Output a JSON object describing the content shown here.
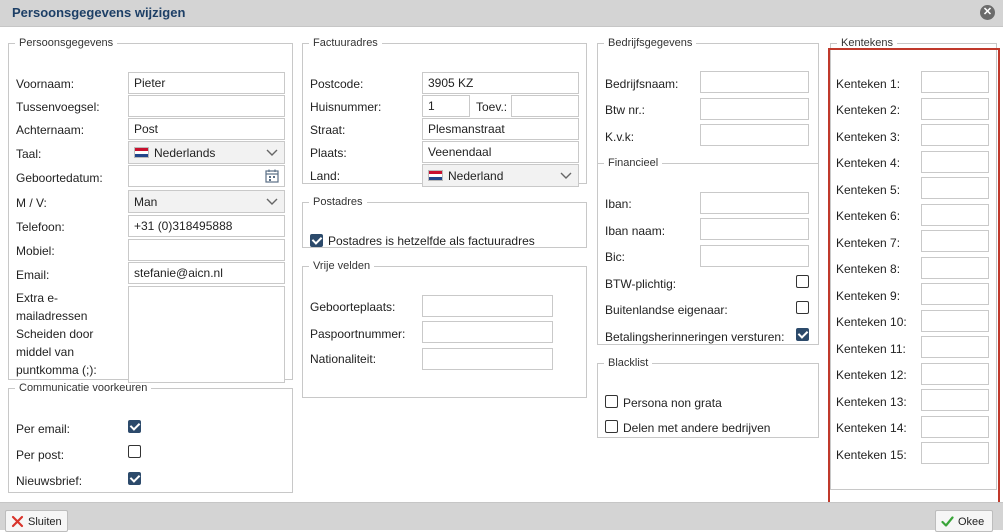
{
  "dialog": {
    "title": "Persoonsgegevens wijzigen",
    "close_icon": "close-icon"
  },
  "persoonsgegevens": {
    "legend": "Persoonsgegevens",
    "voornaam": {
      "label": "Voornaam:",
      "value": "Pieter"
    },
    "tussenvoegsel": {
      "label": "Tussenvoegsel:",
      "value": ""
    },
    "achternaam": {
      "label": "Achternaam:",
      "value": "Post"
    },
    "taal": {
      "label": "Taal:",
      "value": "Nederlands"
    },
    "geboortedatum": {
      "label": "Geboortedatum:",
      "value": ""
    },
    "mv": {
      "label": "M / V:",
      "value": "Man"
    },
    "telefoon": {
      "label": "Telefoon:",
      "value": "+31 (0)318495888"
    },
    "mobiel": {
      "label": "Mobiel:",
      "value": ""
    },
    "email": {
      "label": "Email:",
      "value": "stefanie@aicn.nl"
    },
    "extra": {
      "label_lines": [
        "Extra e-",
        "mailadressen",
        "Scheiden door",
        "middel van",
        "puntkomma (;):"
      ],
      "value": ""
    }
  },
  "communicatie": {
    "legend": "Communicatie voorkeuren",
    "items": [
      {
        "label": "Per email:",
        "checked": true
      },
      {
        "label": "Per post:",
        "checked": false
      },
      {
        "label": "Nieuwsbrief:",
        "checked": true
      }
    ]
  },
  "factuuradres": {
    "legend": "Factuuradres",
    "postcode": {
      "label": "Postcode:",
      "value": "3905 KZ"
    },
    "huisnummer": {
      "label": "Huisnummer:",
      "value": "1"
    },
    "toev": {
      "label": "Toev.:",
      "value": ""
    },
    "straat": {
      "label": "Straat:",
      "value": "Plesmanstraat"
    },
    "plaats": {
      "label": "Plaats:",
      "value": "Veenendaal"
    },
    "land": {
      "label": "Land:",
      "value": "Nederland"
    }
  },
  "postadres": {
    "legend": "Postadres",
    "checkbox_label": "Postadres is hetzelfde als factuuradres",
    "checked": true
  },
  "vrije_velden": {
    "legend": "Vrije velden",
    "fields": [
      {
        "label": "Geboorteplaats:",
        "value": ""
      },
      {
        "label": "Paspoortnummer:",
        "value": ""
      },
      {
        "label": "Nationaliteit:",
        "value": ""
      }
    ]
  },
  "bedrijfsgegevens": {
    "legend": "Bedrijfsgegevens",
    "fields": [
      {
        "label": "Bedrijfsnaam:",
        "value": ""
      },
      {
        "label": "Btw nr.:",
        "value": ""
      },
      {
        "label": "K.v.k:",
        "value": ""
      }
    ]
  },
  "financieel": {
    "legend": "Financieel",
    "fields": [
      {
        "label": "Iban:",
        "value": ""
      },
      {
        "label": "Iban naam:",
        "value": ""
      },
      {
        "label": "Bic:",
        "value": ""
      }
    ],
    "checkboxes": [
      {
        "label": "BTW-plichtig:",
        "checked": false
      },
      {
        "label": "Buitenlandse eigenaar:",
        "checked": false
      },
      {
        "label": "Betalingsherinneringen versturen:",
        "checked": true
      }
    ]
  },
  "blacklist": {
    "legend": "Blacklist",
    "items": [
      {
        "label": "Persona non grata",
        "checked": false
      },
      {
        "label": "Delen met andere bedrijven",
        "checked": false
      }
    ]
  },
  "kentekens": {
    "legend": "Kentekens",
    "items": [
      {
        "label": "Kenteken 1:",
        "value": ""
      },
      {
        "label": "Kenteken 2:",
        "value": ""
      },
      {
        "label": "Kenteken 3:",
        "value": ""
      },
      {
        "label": "Kenteken 4:",
        "value": ""
      },
      {
        "label": "Kenteken 5:",
        "value": ""
      },
      {
        "label": "Kenteken 6:",
        "value": ""
      },
      {
        "label": "Kenteken 7:",
        "value": ""
      },
      {
        "label": "Kenteken 8:",
        "value": ""
      },
      {
        "label": "Kenteken 9:",
        "value": ""
      },
      {
        "label": "Kenteken 10:",
        "value": ""
      },
      {
        "label": "Kenteken 11:",
        "value": ""
      },
      {
        "label": "Kenteken 12:",
        "value": ""
      },
      {
        "label": "Kenteken 13:",
        "value": ""
      },
      {
        "label": "Kenteken 14:",
        "value": ""
      },
      {
        "label": "Kenteken 15:",
        "value": ""
      }
    ]
  },
  "footer": {
    "close_label": "Sluiten",
    "ok_label": "Okee"
  },
  "colors": {
    "title": "#1d3f66",
    "highlight": "#c0392b",
    "checkbox": "#2c4a6b"
  }
}
